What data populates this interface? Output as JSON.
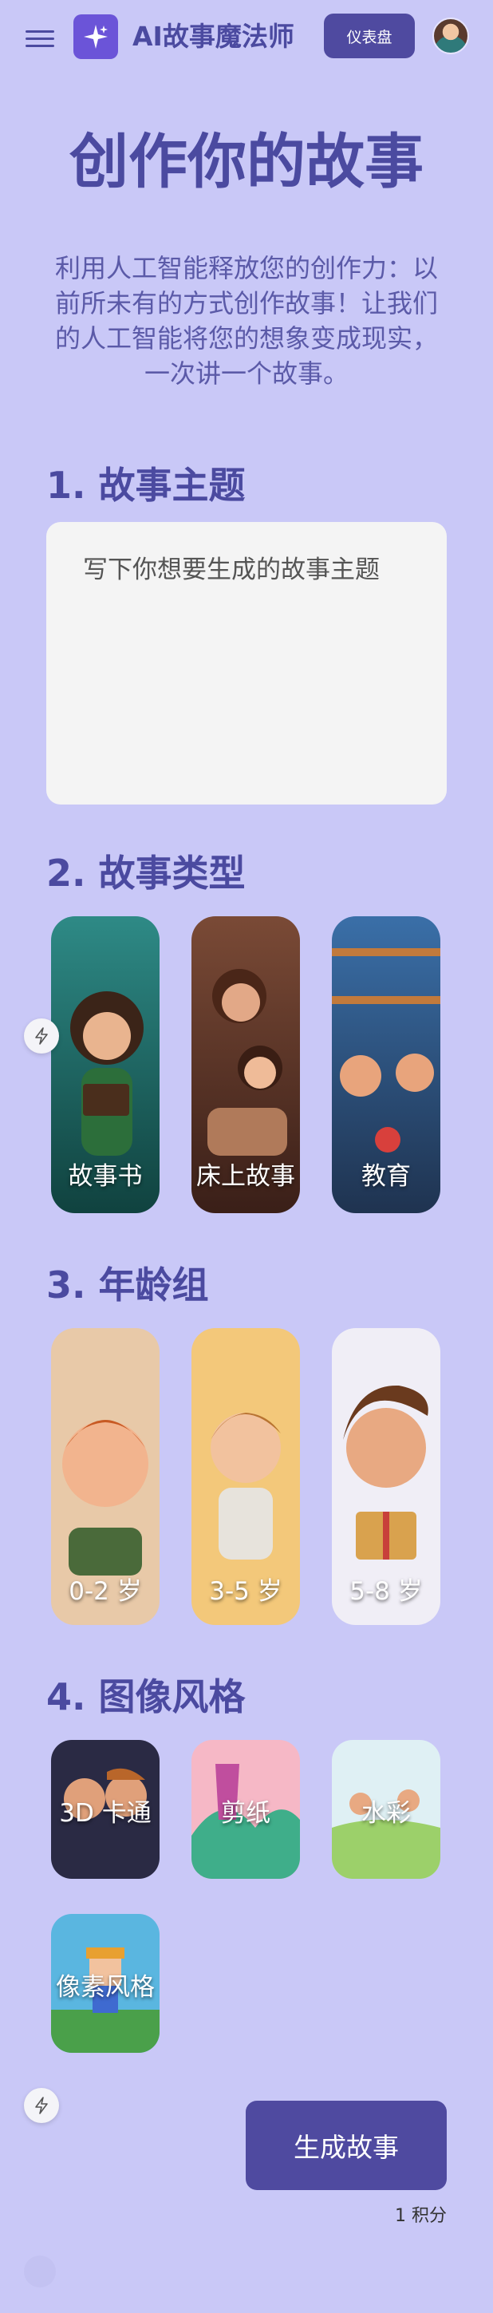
{
  "header": {
    "app_title": "AI故事魔法师",
    "dashboard_label": "仪表盘",
    "logo_icon": "sparkle-icon",
    "menu_icon": "hamburger-menu-icon"
  },
  "main": {
    "title": "创作你的故事",
    "intro": "利用人工智能释放您的创作力：以前所未有的方式创作故事！让我们的人工智能将您的想象变成现实，一次讲一个故事。"
  },
  "topic": {
    "heading": "1. 故事主题",
    "placeholder": "写下你想要生成的故事主题"
  },
  "story_type": {
    "heading": "2. 故事类型",
    "options": [
      {
        "label": "故事书"
      },
      {
        "label": "床上故事"
      },
      {
        "label": "教育"
      }
    ]
  },
  "age_group": {
    "heading": "3. 年龄组",
    "options": [
      {
        "label": "0-2 岁"
      },
      {
        "label": "3-5 岁"
      },
      {
        "label": "5-8 岁"
      }
    ]
  },
  "image_style": {
    "heading": "4. 图像风格",
    "options": [
      {
        "label": "3D 卡通"
      },
      {
        "label": "剪纸"
      },
      {
        "label": "水彩"
      },
      {
        "label": "像素风格"
      }
    ]
  },
  "actions": {
    "generate_label": "生成故事",
    "credits": "1 积分"
  },
  "colors": {
    "background": "#c9c8f7",
    "primary": "#4f4aa0",
    "accent": "#6b54d8"
  }
}
